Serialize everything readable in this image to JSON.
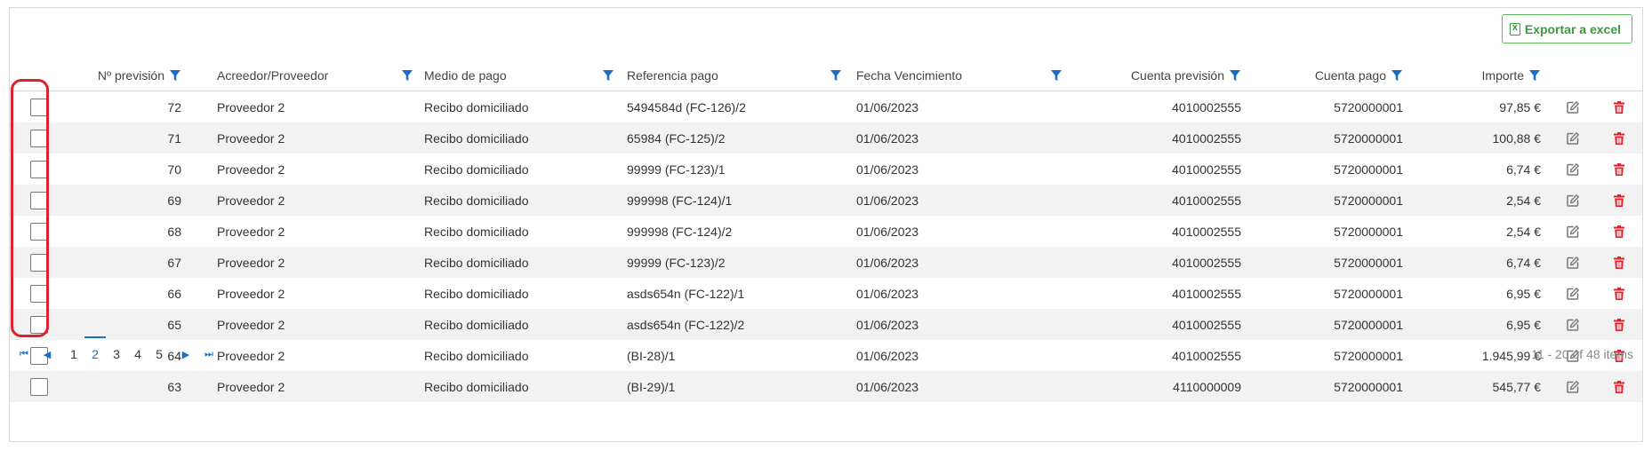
{
  "toolbar": {
    "export_label": "Exportar a excel"
  },
  "columns": {
    "num": "Nº previsión",
    "proveedor": "Acreedor/Proveedor",
    "medio": "Medio de pago",
    "referencia": "Referencia pago",
    "fecha": "Fecha Vencimiento",
    "cuenta_prev": "Cuenta previsión",
    "cuenta_pago": "Cuenta pago",
    "importe": "Importe"
  },
  "rows": [
    {
      "num": "72",
      "proveedor": "Proveedor 2",
      "medio": "Recibo domiciliado",
      "referencia": "5494584d (FC-126)/2",
      "fecha": "01/06/2023",
      "cuenta_prev": "4010002555",
      "cuenta_pago": "5720000001",
      "importe": "97,85 €"
    },
    {
      "num": "71",
      "proveedor": "Proveedor 2",
      "medio": "Recibo domiciliado",
      "referencia": "65984 (FC-125)/2",
      "fecha": "01/06/2023",
      "cuenta_prev": "4010002555",
      "cuenta_pago": "5720000001",
      "importe": "100,88 €"
    },
    {
      "num": "70",
      "proveedor": "Proveedor 2",
      "medio": "Recibo domiciliado",
      "referencia": "99999 (FC-123)/1",
      "fecha": "01/06/2023",
      "cuenta_prev": "4010002555",
      "cuenta_pago": "5720000001",
      "importe": "6,74 €"
    },
    {
      "num": "69",
      "proveedor": "Proveedor 2",
      "medio": "Recibo domiciliado",
      "referencia": "999998 (FC-124)/1",
      "fecha": "01/06/2023",
      "cuenta_prev": "4010002555",
      "cuenta_pago": "5720000001",
      "importe": "2,54 €"
    },
    {
      "num": "68",
      "proveedor": "Proveedor 2",
      "medio": "Recibo domiciliado",
      "referencia": "999998 (FC-124)/2",
      "fecha": "01/06/2023",
      "cuenta_prev": "4010002555",
      "cuenta_pago": "5720000001",
      "importe": "2,54 €"
    },
    {
      "num": "67",
      "proveedor": "Proveedor 2",
      "medio": "Recibo domiciliado",
      "referencia": "99999 (FC-123)/2",
      "fecha": "01/06/2023",
      "cuenta_prev": "4010002555",
      "cuenta_pago": "5720000001",
      "importe": "6,74 €"
    },
    {
      "num": "66",
      "proveedor": "Proveedor 2",
      "medio": "Recibo domiciliado",
      "referencia": "asds654n (FC-122)/1",
      "fecha": "01/06/2023",
      "cuenta_prev": "4010002555",
      "cuenta_pago": "5720000001",
      "importe": "6,95 €"
    },
    {
      "num": "65",
      "proveedor": "Proveedor 2",
      "medio": "Recibo domiciliado",
      "referencia": "asds654n (FC-122)/2",
      "fecha": "01/06/2023",
      "cuenta_prev": "4010002555",
      "cuenta_pago": "5720000001",
      "importe": "6,95 €"
    },
    {
      "num": "64",
      "proveedor": "Proveedor 2",
      "medio": "Recibo domiciliado",
      "referencia": "(BI-28)/1",
      "fecha": "01/06/2023",
      "cuenta_prev": "4010002555",
      "cuenta_pago": "5720000001",
      "importe": "1.945,99 €"
    },
    {
      "num": "63",
      "proveedor": "Proveedor 2",
      "medio": "Recibo domiciliado",
      "referencia": "(BI-29)/1",
      "fecha": "01/06/2023",
      "cuenta_prev": "4110000009",
      "cuenta_pago": "5720000001",
      "importe": "545,77 €"
    }
  ],
  "pager": {
    "pages": [
      "1",
      "2",
      "3",
      "4",
      "5"
    ],
    "active_page": "2",
    "info": "11 - 20 of 48 items"
  },
  "colors": {
    "accent": "#1a6fc4",
    "export_green": "#3c9a3c",
    "delete_red": "#e0202a",
    "highlight_red": "#d9232d"
  },
  "icons": [
    "filter-icon",
    "edit-icon",
    "trash-icon",
    "excel-icon",
    "first-page-icon",
    "prev-page-icon",
    "next-page-icon",
    "last-page-icon"
  ]
}
